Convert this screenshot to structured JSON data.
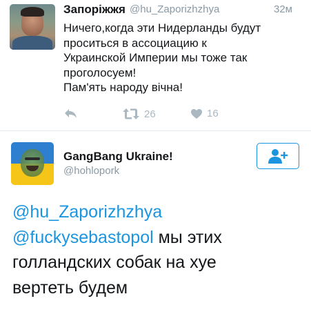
{
  "tweet1": {
    "author_name": "Запоріжжя",
    "handle": "@hu_Zaporizhzhya",
    "time": "32м",
    "lines": [
      "Ничего,когда эти Нидерланды будут",
      "проситься в ассоциацию к",
      "Украинской Империи мы тоже так",
      "проголосуем!",
      "Пам'ять народу вічна!"
    ],
    "retweets": "26",
    "likes": "16"
  },
  "tweet2": {
    "author_name": "GangBang Ukraine!",
    "handle": "@hohlopork",
    "mention1": "@hu_Zaporizhzhya",
    "mention2": "@fuckysebastopol",
    "line2_rest": " мы этих",
    "line3": "голландских собак на хуе",
    "line4": "вертеть будем"
  },
  "colors": {
    "accent": "#1b95e0",
    "muted": "#8899a6",
    "icon": "#aab8c2",
    "text": "#14171a"
  }
}
